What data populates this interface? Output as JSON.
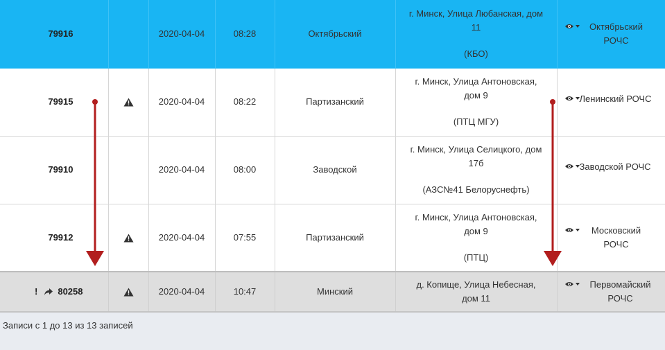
{
  "rows": [
    {
      "id": "79916",
      "warning": false,
      "date": "2020-04-04",
      "time": "08:28",
      "district": "Октябрьский",
      "address_line1": "г. Минск, Улица Любанская, дом",
      "address_line2": "11",
      "address_note": "(КБО)",
      "unit": "Октябрьский РОЧС"
    },
    {
      "id": "79915",
      "warning": true,
      "date": "2020-04-04",
      "time": "08:22",
      "district": "Партизанский",
      "address_line1": "г. Минск, Улица Антоновская,",
      "address_line2": "дом 9",
      "address_note": "(ПТЦ МГУ)",
      "unit": "Ленинский РОЧС"
    },
    {
      "id": "79910",
      "warning": false,
      "date": "2020-04-04",
      "time": "08:00",
      "district": "Заводской",
      "address_line1": "г. Минск, Улица Селицкого, дом",
      "address_line2": "17б",
      "address_note": "(АЗС№41 Белоруснефть)",
      "unit": "Заводской РОЧС"
    },
    {
      "id": "79912",
      "warning": true,
      "date": "2020-04-04",
      "time": "07:55",
      "district": "Партизанский",
      "address_line1": "г. Минск, Улица Антоновская,",
      "address_line2": "дом 9",
      "address_note": "(ПТЦ)",
      "unit": "Московский РОЧС"
    },
    {
      "id": "80258",
      "prefix": "!",
      "warning": true,
      "date": "2020-04-04",
      "time": "10:47",
      "district": "Минский",
      "address_line1": "д. Копище, Улица Небесная,",
      "address_line2": "дом 11",
      "address_note": "",
      "unit": "Первомайский РОЧС"
    }
  ],
  "footer": {
    "info": "Записи с 1 до 13 из 13 записей"
  },
  "colors": {
    "selected_row": "#19b5f3",
    "highlight_row": "#dedede",
    "arrow": "#b21e1e"
  },
  "icons": {
    "warning": "warning-icon",
    "eye": "eye-icon",
    "caret": "caret-down-icon",
    "share": "share-icon"
  }
}
